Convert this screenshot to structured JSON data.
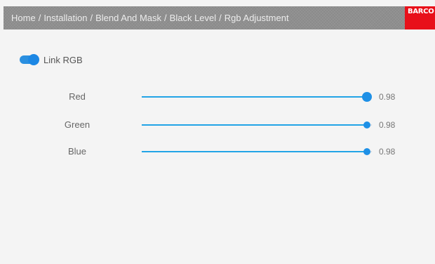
{
  "header": {
    "breadcrumb": [
      "Home",
      "Installation",
      "Blend And Mask",
      "Black Level",
      "Rgb Adjustment"
    ],
    "separator": "/",
    "logo_text": "BARCO",
    "logo_color": "#e8101a"
  },
  "link_rgb": {
    "label": "Link RGB",
    "enabled": true
  },
  "sliders": [
    {
      "label": "Red",
      "value_text": "0.98",
      "value": 0.98,
      "active": true
    },
    {
      "label": "Green",
      "value_text": "0.98",
      "value": 0.98,
      "active": false
    },
    {
      "label": "Blue",
      "value_text": "0.98",
      "value": 0.98,
      "active": false
    }
  ],
  "colors": {
    "accent": "#1e90e6",
    "track_fill": "#22a4e6"
  }
}
